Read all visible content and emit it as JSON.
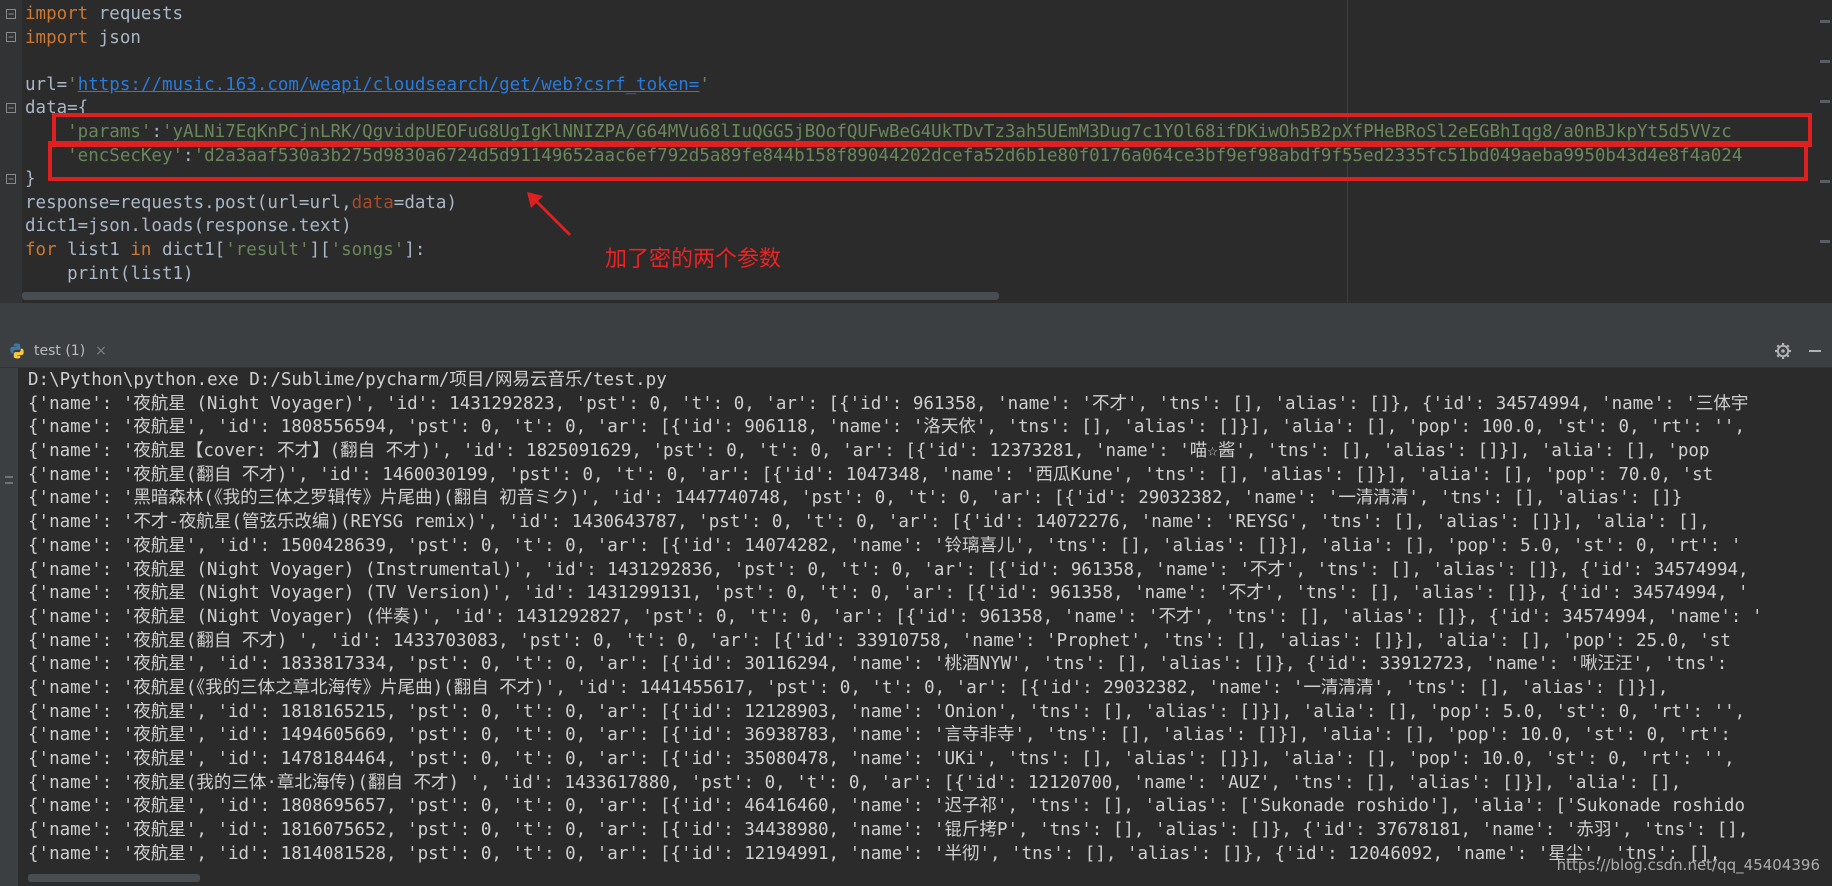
{
  "editor": {
    "lines": [
      [
        {
          "t": "import ",
          "c": "kw"
        },
        {
          "t": "requests",
          "c": "var"
        }
      ],
      [
        {
          "t": "import ",
          "c": "kw"
        },
        {
          "t": "json",
          "c": "var"
        }
      ],
      [],
      [
        {
          "t": "url=",
          "c": "var"
        },
        {
          "t": "'",
          "c": "st"
        },
        {
          "t": "https://music.163.com/weapi/cloudsearch/get/web?csrf_token=",
          "c": "url"
        },
        {
          "t": "'",
          "c": "st"
        }
      ],
      [
        {
          "t": "data={",
          "c": "var"
        }
      ],
      [
        {
          "t": "    'params'",
          "c": "st"
        },
        {
          "t": ":",
          "c": "var"
        },
        {
          "t": "'yALNi7EqKnPCjnLRK/QgvidpUEOFuG8UgIgKlNNIZPA/G64MVu68lIuQGG5jBOofQUFwBeG4UkTDvTz3ah5UEmM3Dug7c1YOl68ifDKiwOh5B2pXfPHeBRoSl2eEGBhIqg8/a0nBJkpYt5d5VVzc",
          "c": "st"
        }
      ],
      [
        {
          "t": "    'encSecKey'",
          "c": "st"
        },
        {
          "t": ":",
          "c": "var"
        },
        {
          "t": "'d2a3aaf530a3b275d9830a6724d5d91149652aac6ef792d5a89fe844b158f89044202dcefa52d6b1e80f0176a064ce3bf9ef98abdf9f55ed2335fc51bd049aeba9950b43d4e8f4a024",
          "c": "st"
        }
      ],
      [
        {
          "t": "}",
          "c": "var"
        }
      ],
      [
        {
          "t": "response=requests.post(url=url,",
          "c": "var"
        },
        {
          "t": "data",
          "c": "par"
        },
        {
          "t": "=data)",
          "c": "var"
        }
      ],
      [
        {
          "t": "dict1=json.loads(response.text)",
          "c": "var"
        }
      ],
      [
        {
          "t": "for ",
          "c": "kw"
        },
        {
          "t": "list1 ",
          "c": "var"
        },
        {
          "t": "in ",
          "c": "kw"
        },
        {
          "t": "dict1[",
          "c": "var"
        },
        {
          "t": "'result'",
          "c": "st"
        },
        {
          "t": "][",
          "c": "var"
        },
        {
          "t": "'songs'",
          "c": "st"
        },
        {
          "t": "]:",
          "c": "var"
        }
      ],
      [
        {
          "t": "    print(list1)",
          "c": "var"
        }
      ]
    ]
  },
  "annotation": {
    "label": "加了密的两个参数",
    "color": "#e02020"
  },
  "run_panel": {
    "tab_label": "test (1)",
    "close_glyph": "×"
  },
  "console": {
    "lines": [
      "D:\\Python\\python.exe D:/Sublime/pycharm/项目/网易云音乐/test.py",
      "{'name': '夜航星 (Night Voyager)', 'id': 1431292823, 'pst': 0, 't': 0, 'ar': [{'id': 961358, 'name': '不才', 'tns': [], 'alias': []}, {'id': 34574994, 'name': '三体宇",
      "{'name': '夜航星', 'id': 1808556594, 'pst': 0, 't': 0, 'ar': [{'id': 906118, 'name': '洛天依', 'tns': [], 'alias': []}], 'alia': [], 'pop': 100.0, 'st': 0, 'rt': '',",
      "{'name': '夜航星【cover: 不才】(翻自 不才)', 'id': 1825091629, 'pst': 0, 't': 0, 'ar': [{'id': 12373281, 'name': '喵☆酱', 'tns': [], 'alias': []}], 'alia': [], 'pop",
      "{'name': '夜航星(翻自 不才)', 'id': 1460030199, 'pst': 0, 't': 0, 'ar': [{'id': 1047348, 'name': '西瓜Kune', 'tns': [], 'alias': []}], 'alia': [], 'pop': 70.0, 'st",
      "{'name': '黑暗森林(《我的三体之罗辑传》片尾曲)(翻自 初音ミク)', 'id': 1447740748, 'pst': 0, 't': 0, 'ar': [{'id': 29032382, 'name': '一清清清', 'tns': [], 'alias': []}",
      "{'name': '不才-夜航星(管弦乐改编)(REYSG remix)', 'id': 1430643787, 'pst': 0, 't': 0, 'ar': [{'id': 14072276, 'name': 'REYSG', 'tns': [], 'alias': []}], 'alia': [],",
      "{'name': '夜航星', 'id': 1500428639, 'pst': 0, 't': 0, 'ar': [{'id': 14074282, 'name': '铃璃喜儿', 'tns': [], 'alias': []}], 'alia': [], 'pop': 5.0, 'st': 0, 'rt': '",
      "{'name': '夜航星 (Night Voyager) (Instrumental)', 'id': 1431292836, 'pst': 0, 't': 0, 'ar': [{'id': 961358, 'name': '不才', 'tns': [], 'alias': []}, {'id': 34574994,",
      "{'name': '夜航星 (Night Voyager) (TV Version)', 'id': 1431299131, 'pst': 0, 't': 0, 'ar': [{'id': 961358, 'name': '不才', 'tns': [], 'alias': []}, {'id': 34574994, '",
      "{'name': '夜航星 (Night Voyager) (伴奏)', 'id': 1431292827, 'pst': 0, 't': 0, 'ar': [{'id': 961358, 'name': '不才', 'tns': [], 'alias': []}, {'id': 34574994, 'name': '",
      "{'name': '夜航星(翻自 不才) ', 'id': 1433703083, 'pst': 0, 't': 0, 'ar': [{'id': 33910758, 'name': 'Prophet', 'tns': [], 'alias': []}], 'alia': [], 'pop': 25.0, 'st",
      "{'name': '夜航星', 'id': 1833817334, 'pst': 0, 't': 0, 'ar': [{'id': 30116294, 'name': '桃酒NYW', 'tns': [], 'alias': []}, {'id': 33912723, 'name': '啾汪汪', 'tns':",
      "{'name': '夜航星(《我的三体之章北海传》片尾曲)(翻自 不才)', 'id': 1441455617, 'pst': 0, 't': 0, 'ar': [{'id': 29032382, 'name': '一清清清', 'tns': [], 'alias': []}],",
      "{'name': '夜航星', 'id': 1818165215, 'pst': 0, 't': 0, 'ar': [{'id': 12128903, 'name': 'Onion', 'tns': [], 'alias': []}], 'alia': [], 'pop': 5.0, 'st': 0, 'rt': '',",
      "{'name': '夜航星', 'id': 1494605669, 'pst': 0, 't': 0, 'ar': [{'id': 36938783, 'name': '言寺非寺', 'tns': [], 'alias': []}], 'alia': [], 'pop': 10.0, 'st': 0, 'rt':",
      "{'name': '夜航星', 'id': 1478184464, 'pst': 0, 't': 0, 'ar': [{'id': 35080478, 'name': 'UKi', 'tns': [], 'alias': []}], 'alia': [], 'pop': 10.0, 'st': 0, 'rt': '',",
      "{'name': '夜航星(我的三体·章北海传)(翻自 不才) ', 'id': 1433617880, 'pst': 0, 't': 0, 'ar': [{'id': 12120700, 'name': 'AUZ', 'tns': [], 'alias': []}], 'alia': [],",
      "{'name': '夜航星', 'id': 1808695657, 'pst': 0, 't': 0, 'ar': [{'id': 46416460, 'name': '迟子祁', 'tns': [], 'alias': ['Sukonade roshido'], 'alia': ['Sukonade roshido",
      "{'name': '夜航星', 'id': 1816075652, 'pst': 0, 't': 0, 'ar': [{'id': 34438980, 'name': '锟斤拷P', 'tns': [], 'alias': []}, {'id': 37678181, 'name': '赤羽', 'tns': [],",
      "{'name': '夜航星', 'id': 1814081528, 'pst': 0, 't': 0, 'ar': [{'id': 12194991, 'name': '半彻', 'tns': [], 'alias': []}, {'id': 12046092, 'name': '星尘', 'tns': [],"
    ]
  },
  "watermark": "https://blog.csdn.net/qq_45404396"
}
